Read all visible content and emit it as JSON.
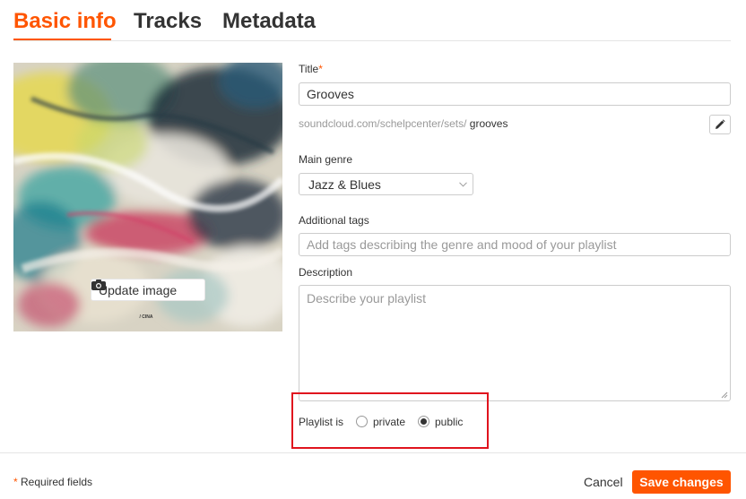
{
  "tabs": [
    {
      "label": "Basic info",
      "active": true
    },
    {
      "label": "Tracks",
      "active": false
    },
    {
      "label": "Metadata",
      "active": false
    }
  ],
  "artwork": {
    "update_label": "Update image",
    "caption": " / CINA"
  },
  "form": {
    "title_label": "Title",
    "required_mark": "*",
    "title_value": "Grooves",
    "permalink_base": "soundcloud.com/schelpcenter/sets/",
    "permalink_slug": "grooves",
    "genre_label": "Main genre",
    "genre_value": "Jazz & Blues",
    "tags_label": "Additional tags",
    "tags_placeholder": "Add tags describing the genre and mood of your playlist",
    "description_label": "Description",
    "description_placeholder": "Describe your playlist",
    "privacy_label": "Playlist is",
    "privacy_options": [
      {
        "label": "private",
        "checked": false
      },
      {
        "label": "public",
        "checked": true
      }
    ]
  },
  "footer": {
    "required_mark": "*",
    "required_note": "Required fields",
    "cancel_label": "Cancel",
    "save_label": "Save changes"
  },
  "colors": {
    "accent": "#ff5500",
    "highlight_box": "#e0141e"
  },
  "icons": [
    "camera-icon",
    "pencil-icon",
    "chevron-down-icon",
    "resize-grip-icon"
  ]
}
